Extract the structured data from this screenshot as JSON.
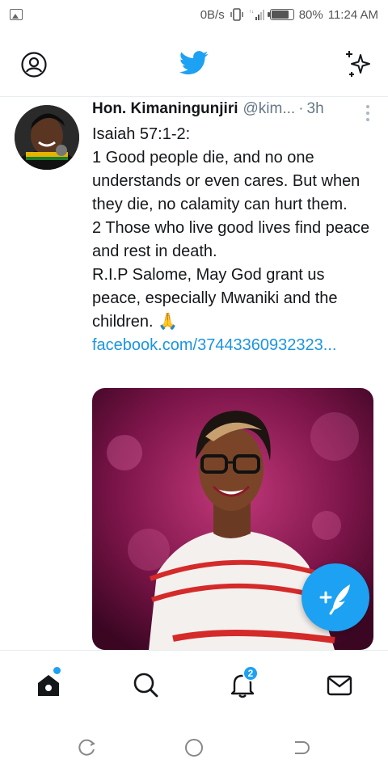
{
  "status_bar": {
    "data_speed": "0B/s",
    "battery": "80%",
    "battery_level": 0.8,
    "time": "11:24 AM"
  },
  "app_bar": {
    "logo_icon": "twitter-bird-icon",
    "profile_icon": "profile-icon",
    "sparkle_icon": "sparkle-icon"
  },
  "tweet": {
    "author_name": "Hon. Kimaningunjiri",
    "handle": "@kim...",
    "separator": "·",
    "time": "3h",
    "lines": [
      "Isaiah 57:1-2:",
      "1 Good people die, and no one understands or even cares. But when they die, no calamity can hurt them.",
      "2 Those who live good lives find peace and rest in death.",
      "R.I.P Salome, May God grant us peace, especially Mwaniki and the children. 🙏"
    ],
    "link": "facebook.com/37443360932323..."
  },
  "bottom_nav": {
    "notifications_badge": "2",
    "items": [
      "home-icon",
      "search-icon",
      "bell-icon",
      "mail-icon"
    ]
  },
  "system_nav": {
    "items": [
      "recents-icon",
      "home-circle-icon",
      "back-icon"
    ]
  },
  "colors": {
    "accent": "#1da1f2",
    "link": "#1b95e0",
    "text": "#14171a",
    "muted": "#657786"
  }
}
